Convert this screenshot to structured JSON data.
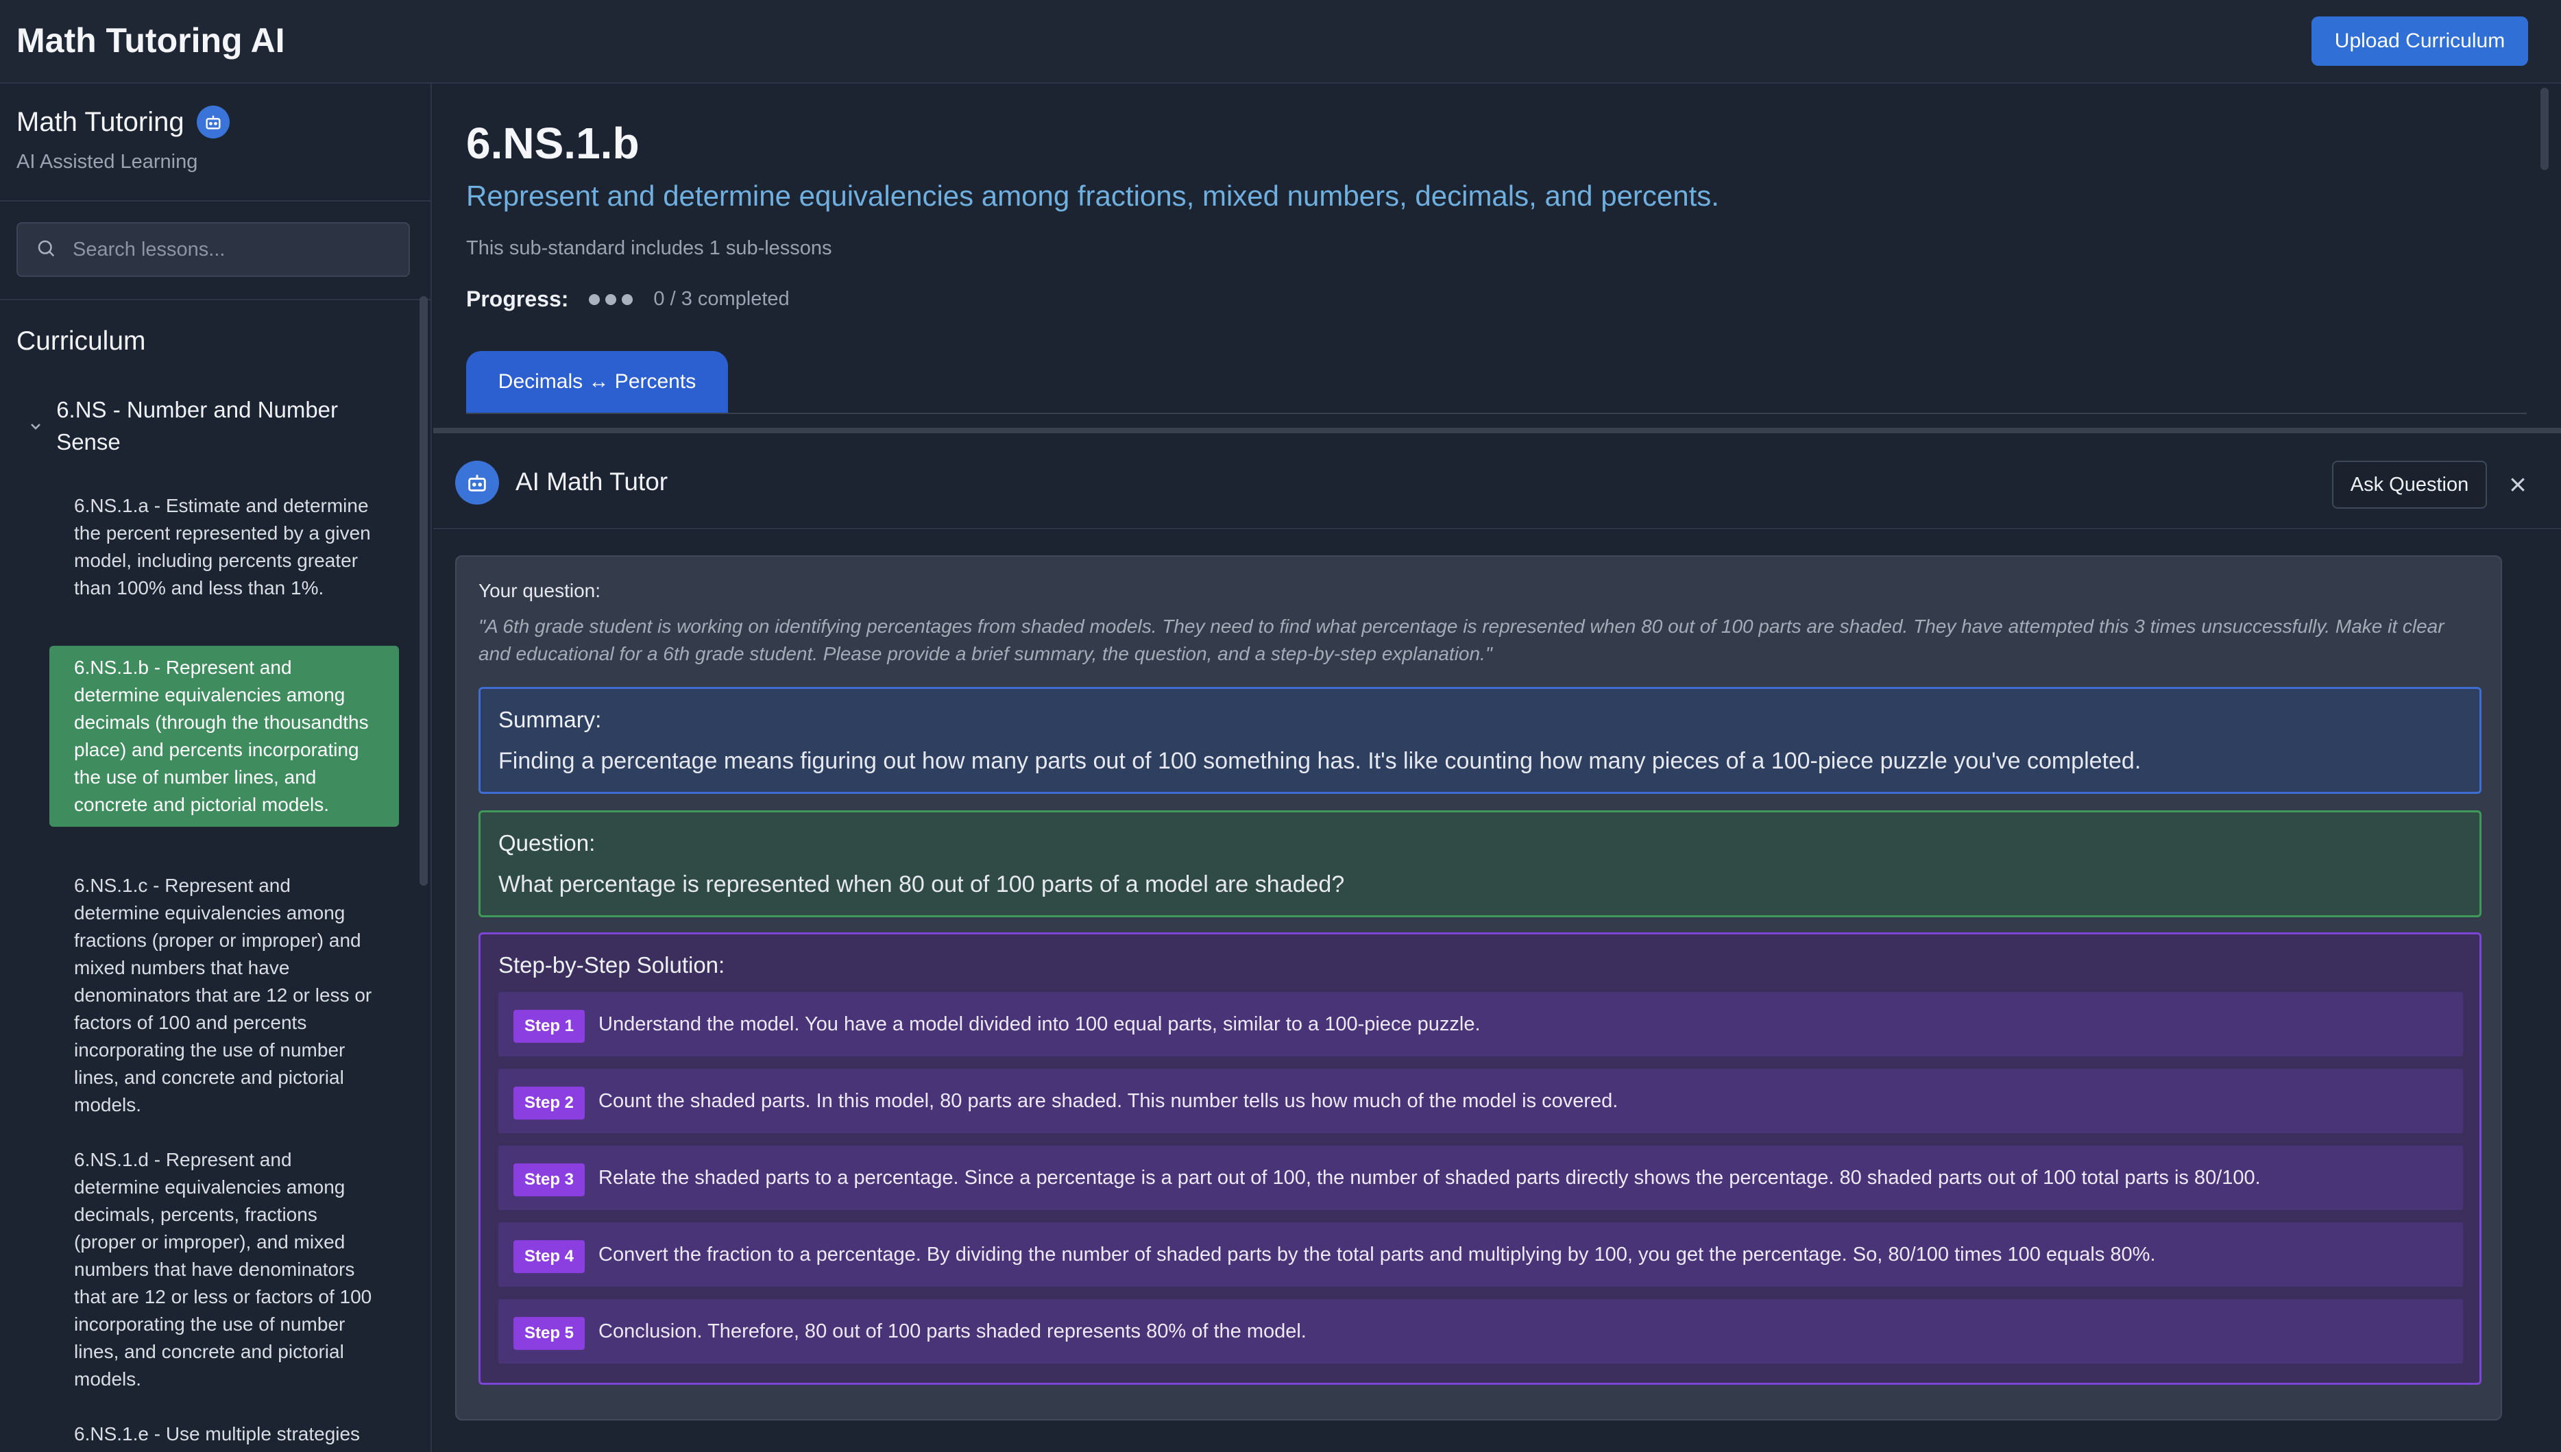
{
  "app": {
    "title": "Math Tutoring AI",
    "upload_label": "Upload Curriculum"
  },
  "sidebar": {
    "brand": "Math Tutoring",
    "brand_sub": "AI Assisted Learning",
    "search_placeholder": "Search lessons...",
    "curriculum_heading": "Curriculum",
    "section_label": "6.NS - Number and Number Sense",
    "lessons": [
      {
        "label": "6.NS.1.a - Estimate and determine the percent represented by a given model, including percents greater than 100% and less than 1%."
      },
      {
        "label": "6.NS.1.b - Represent and determine equivalencies among decimals (through the thousandths place) and percents incorporating the use of number lines, and concrete and pictorial models."
      },
      {
        "label": "6.NS.1.c - Represent and determine equivalencies among fractions (proper or improper) and mixed numbers that have denominators that are 12 or less or factors of 100 and percents incorporating the use of number lines, and concrete and pictorial models."
      },
      {
        "label": "6.NS.1.d - Represent and determine equivalencies among decimals, percents, fractions (proper or improper), and mixed numbers that have denominators that are 12 or less or factors of 100 incorporating the use of number lines, and concrete and pictorial models."
      },
      {
        "label": "6.NS.1.e - Use multiple strategies"
      }
    ]
  },
  "main": {
    "code": "6.NS.1.b",
    "description": "Represent and determine equivalencies among fractions, mixed numbers, decimals, and percents.",
    "note": "This sub-standard includes 1 sub-lessons",
    "progress_label": "Progress:",
    "progress_text": "0 / 3 completed",
    "progress": {
      "completed": 0,
      "total": 3
    },
    "tab_label": "Decimals ↔ Percents"
  },
  "tutor": {
    "title": "AI Math Tutor",
    "ask_label": "Ask Question",
    "question_label": "Your question:",
    "question_text": "\"A 6th grade student is working on identifying percentages from shaded models. They need to find what percentage is represented when 80 out of 100 parts are shaded. They have attempted this 3 times unsuccessfully. Make it clear and educational for a 6th grade student. Please provide a brief summary, the question, and a step-by-step explanation.\"",
    "summary_title": "Summary:",
    "summary_text": "Finding a percentage means figuring out how many parts out of 100 something has. It's like counting how many pieces of a 100-piece puzzle you've completed.",
    "question_title": "Question:",
    "question_body": "What percentage is represented when 80 out of 100 parts of a model are shaded?",
    "steps_title": "Step-by-Step Solution:",
    "steps": [
      {
        "badge": "Step 1",
        "text": "Understand the model. You have a model divided into 100 equal parts, similar to a 100-piece puzzle."
      },
      {
        "badge": "Step 2",
        "text": "Count the shaded parts. In this model, 80 parts are shaded. This number tells us how much of the model is covered."
      },
      {
        "badge": "Step 3",
        "text": "Relate the shaded parts to a percentage. Since a percentage is a part out of 100, the number of shaded parts directly shows the percentage. 80 shaded parts out of 100 total parts is 80/100."
      },
      {
        "badge": "Step 4",
        "text": "Convert the fraction to a percentage. By dividing the number of shaded parts by the total parts and multiplying by 100, you get the percentage. So, 80/100 times 100 equals 80%."
      },
      {
        "badge": "Step 5",
        "text": "Conclusion. Therefore, 80 out of 100 parts shaded represents 80% of the model."
      }
    ]
  },
  "colors": {
    "accent": "#2f6fd6",
    "active_lesson": "#3f8c5f",
    "step_badge": "#8c3fe0"
  },
  "icons": {
    "robot": "robot-icon",
    "search": "search-icon",
    "chevron": "chevron-down-icon",
    "close": "close-icon"
  }
}
